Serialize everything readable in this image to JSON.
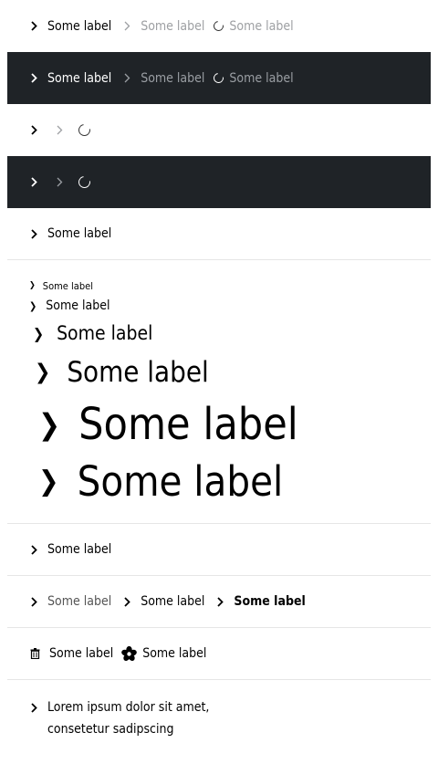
{
  "rows": {
    "r1": {
      "a": "Some label",
      "b": "Some label",
      "c": "Some label"
    },
    "r2": {
      "a": "Some label",
      "b": "Some label",
      "c": "Some label"
    },
    "single": "Some label"
  },
  "sizes": [
    "Some label",
    "Some label",
    "Some label",
    "Some label",
    "Some label",
    "Some label"
  ],
  "after_sizes": "Some label",
  "weights": {
    "light": "Some label",
    "regular": "Some label",
    "bold": "Some label"
  },
  "icons_row": {
    "a": "Some label",
    "b": "Some label"
  },
  "multiline": "Lorem ipsum dolor sit amet, consetetur sadipscing",
  "colors": {
    "dark_bg": "#1f2327",
    "muted": "#9ea0a3",
    "divider": "#e6e6e6"
  }
}
